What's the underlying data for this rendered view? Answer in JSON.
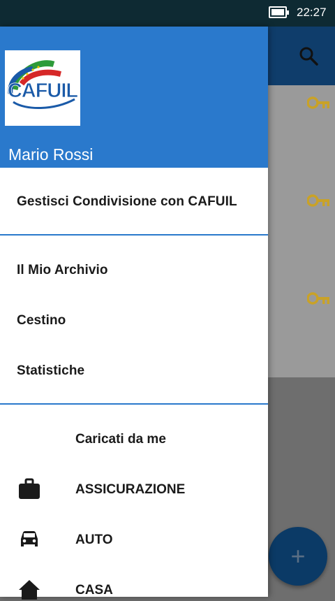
{
  "status_bar": {
    "time": "22:27"
  },
  "drawer": {
    "user_name": "Mario Rossi",
    "share_item": "Gestisci Condivisione con CAFUIL",
    "nav_items": [
      "Il Mio Archivio",
      "Cestino",
      "Statistiche"
    ],
    "section_title": "Caricati da me",
    "categories": [
      {
        "label": "ASSICURAZIONE",
        "icon": "briefcase-icon"
      },
      {
        "label": "AUTO",
        "icon": "car-icon"
      },
      {
        "label": "CASA",
        "icon": "home-icon"
      }
    ]
  },
  "logo": {
    "text": "CAFUIL"
  },
  "fab": {
    "symbol": "+"
  },
  "colors": {
    "accent": "#2a79cc",
    "key": "#c9a227"
  }
}
